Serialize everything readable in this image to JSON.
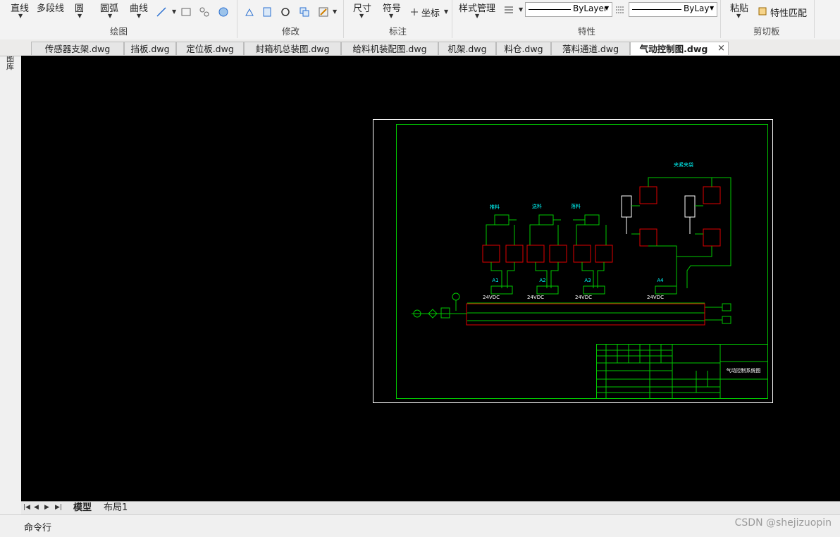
{
  "ribbon": {
    "draw": {
      "line": "直线",
      "polyline": "多段线",
      "circle": "圆",
      "arc": "圆弧",
      "curve": "曲线",
      "group": "绘图"
    },
    "modify": {
      "group": "修改"
    },
    "annotate": {
      "dimension": "尺寸",
      "symbol": "符号",
      "coordinate": "坐标",
      "group": "标注"
    },
    "properties": {
      "style_manager": "样式管理",
      "bylayer_1": "ByLayer",
      "bylayer_2": "ByLay",
      "group": "特性"
    },
    "clipboard": {
      "paste": "粘贴",
      "match_properties": "特性匹配",
      "group": "剪切板"
    }
  },
  "tabs": [
    "传感器支架.dwg",
    "挡板.dwg",
    "定位板.dwg",
    "封箱机总装图.dwg",
    "给料机装配图.dwg",
    "机架.dwg",
    "料仓.dwg",
    "落料通道.dwg",
    "气动控制图.dwg"
  ],
  "active_tab_close": "×",
  "left_panel": {
    "label": "图库"
  },
  "drawing": {
    "labels": {
      "tuiliao": "推料",
      "songliao": "送料",
      "luoliao": "落料",
      "jiajin": "夹紧夹袋"
    },
    "valves": [
      {
        "name": "A1",
        "voltage": "24VDC"
      },
      {
        "name": "A2",
        "voltage": "24VDC"
      },
      {
        "name": "A3",
        "voltage": "24VDC"
      },
      {
        "name": "A4",
        "voltage": "24VDC"
      }
    ],
    "title_block": "气动控制系统图"
  },
  "layout_tabs": {
    "model": "模型",
    "layout1": "布局1"
  },
  "command": {
    "label": "命令行"
  },
  "watermark": "CSDN @shejizuopin",
  "colors": {
    "canvas": "#000000",
    "frame": "#00c800",
    "accent_red": "#e00000",
    "cyan": "#00ffff"
  }
}
